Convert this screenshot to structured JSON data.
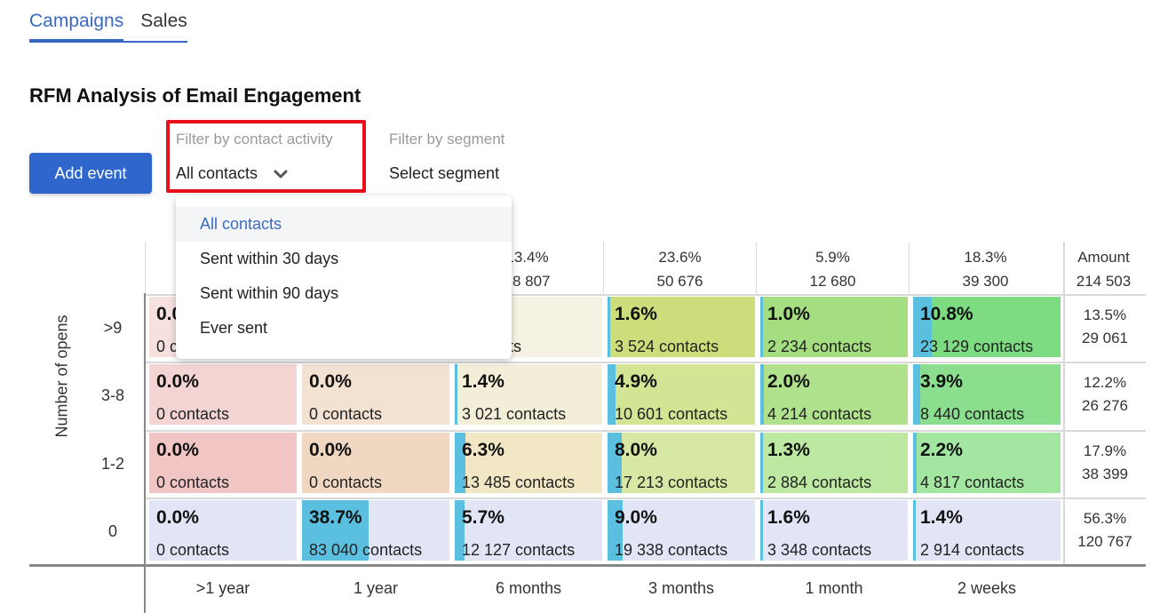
{
  "tabs": [
    {
      "label": "Campaigns",
      "active": true
    },
    {
      "label": "Sales",
      "active": false
    }
  ],
  "page_title": "RFM Analysis of Email Engagement",
  "toolbar": {
    "add_event_label": "Add event"
  },
  "filters": {
    "activity": {
      "label": "Filter by contact activity",
      "value": "All contacts",
      "icon": "chevron-down-icon"
    },
    "segment": {
      "label": "Filter by segment",
      "value": "Select segment"
    }
  },
  "dropdown": {
    "options": [
      "All contacts",
      "Sent within 30 days",
      "Sent within 90 days",
      "Ever sent"
    ],
    "selected_index": 0
  },
  "colors": {
    "accent": "#2f66cc",
    "highlight_border": "#e8101a",
    "bar": "#5bbfdf"
  },
  "chart_data": {
    "type": "heatmap",
    "title": "RFM Analysis of Email Engagement",
    "ylabel": "Number of opens",
    "xlabel": "",
    "x_categories": [
      ">1 year",
      "1 year",
      "6 months",
      "3 months",
      "1 month",
      "2 weeks"
    ],
    "y_categories": [
      ">9",
      "3-8",
      "1-2",
      "0"
    ],
    "column_totals": [
      {
        "pct": "",
        "count": ""
      },
      {
        "pct": "",
        "count": ""
      },
      {
        "pct": "13.4%",
        "count": "28 807",
        "visible_pct": "3.4%",
        "visible_count": "8 807"
      },
      {
        "pct": "23.6%",
        "count": "50 676"
      },
      {
        "pct": "5.9%",
        "count": "12 680"
      },
      {
        "pct": "18.3%",
        "count": "39 300"
      }
    ],
    "amount": {
      "label": "Amount",
      "count": "214 503"
    },
    "row_totals": [
      {
        "pct": "13.5%",
        "count": "29 061"
      },
      {
        "pct": "12.2%",
        "count": "26 276"
      },
      {
        "pct": "17.9%",
        "count": "38 399"
      },
      {
        "pct": "56.3%",
        "count": "120 767"
      }
    ],
    "cells": [
      [
        {
          "pct": "0.0%",
          "count": "0 contacts",
          "share": 0.0,
          "color": "#f6e1df"
        },
        {
          "pct": "",
          "count": "",
          "share": 0.0,
          "color": "#f5e6da"
        },
        {
          "pct": "",
          "count": "contacts",
          "share": 0.0,
          "color": "#f6f2e3"
        },
        {
          "pct": "1.6%",
          "count": "3 524 contacts",
          "share": 1.6,
          "color": "#ccde7c"
        },
        {
          "pct": "1.0%",
          "count": "2 234 contacts",
          "share": 1.0,
          "color": "#a5de80"
        },
        {
          "pct": "10.8%",
          "count": "23 129 contacts",
          "share": 10.8,
          "color": "#7ddb82"
        }
      ],
      [
        {
          "pct": "0.0%",
          "count": "0 contacts",
          "share": 0.0,
          "color": "#f3d4d2"
        },
        {
          "pct": "0.0%",
          "count": "0 contacts",
          "share": 0.0,
          "color": "#f3e1d2"
        },
        {
          "pct": "1.4%",
          "count": "3 021 contacts",
          "share": 1.4,
          "color": "#f3eed8"
        },
        {
          "pct": "4.9%",
          "count": "10 601 contacts",
          "share": 4.9,
          "color": "#d3e494"
        },
        {
          "pct": "2.0%",
          "count": "4 214 contacts",
          "share": 2.0,
          "color": "#b0e28e"
        },
        {
          "pct": "3.9%",
          "count": "8 440 contacts",
          "share": 3.9,
          "color": "#8ade8e"
        }
      ],
      [
        {
          "pct": "0.0%",
          "count": "0 contacts",
          "share": 0.0,
          "color": "#f0c5c4"
        },
        {
          "pct": "0.0%",
          "count": "0 contacts",
          "share": 0.0,
          "color": "#f0d7c2"
        },
        {
          "pct": "6.3%",
          "count": "13 485 contacts",
          "share": 6.3,
          "color": "#f1e7c5"
        },
        {
          "pct": "8.0%",
          "count": "17 213 contacts",
          "share": 8.0,
          "color": "#d7e8a4"
        },
        {
          "pct": "1.3%",
          "count": "2 884 contacts",
          "share": 1.3,
          "color": "#bce8a2"
        },
        {
          "pct": "2.2%",
          "count": "4 817 contacts",
          "share": 2.2,
          "color": "#a2e6a2"
        }
      ],
      [
        {
          "pct": "0.0%",
          "count": "0 contacts",
          "share": 0.0,
          "color": "#e2e5f5"
        },
        {
          "pct": "38.7%",
          "count": "83 040 contacts",
          "share": 38.7,
          "color": "#e2e5f5"
        },
        {
          "pct": "5.7%",
          "count": "12 127 contacts",
          "share": 5.7,
          "color": "#e2e5f5"
        },
        {
          "pct": "9.0%",
          "count": "19 338 contacts",
          "share": 9.0,
          "color": "#e2e5f5"
        },
        {
          "pct": "1.6%",
          "count": "3 348 contacts",
          "share": 1.6,
          "color": "#e2e5f5"
        },
        {
          "pct": "1.4%",
          "count": "2 914 contacts",
          "share": 1.4,
          "color": "#e2e5f5"
        }
      ]
    ]
  }
}
